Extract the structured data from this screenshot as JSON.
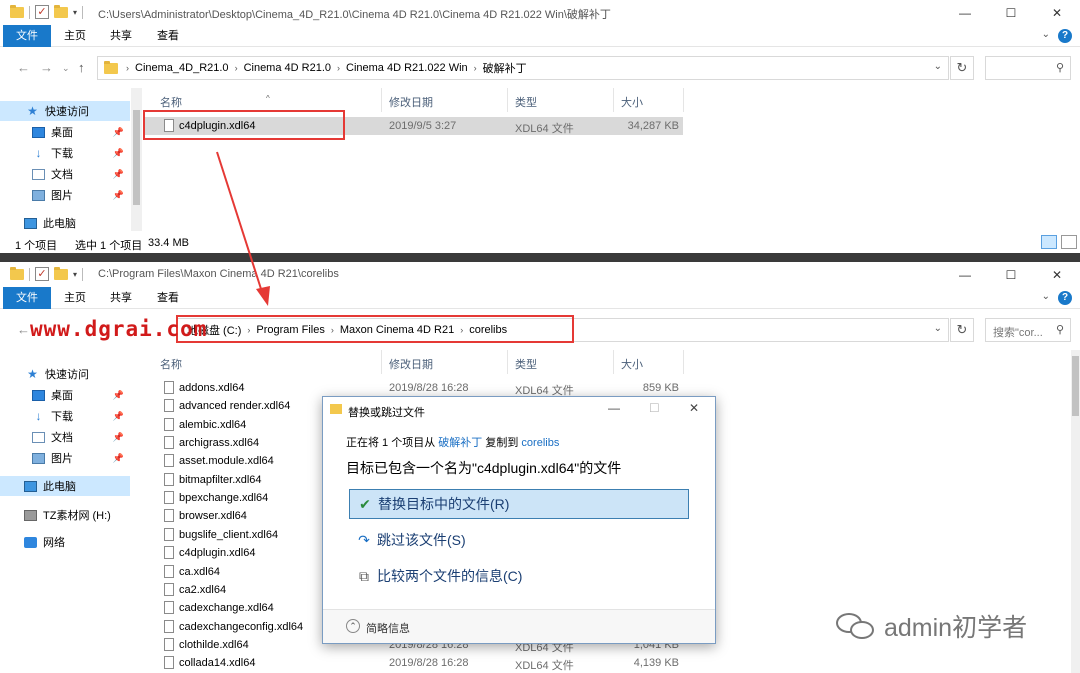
{
  "top_window": {
    "title_path": "C:\\Users\\Administrator\\Desktop\\Cinema_4D_R21.0\\Cinema 4D R21.0\\Cinema 4D R21.022 Win\\破解补丁",
    "ribbon_tabs": [
      "文件",
      "主页",
      "共享",
      "查看"
    ],
    "breadcrumbs": [
      "Cinema_4D_R21.0",
      "Cinema 4D R21.0",
      "Cinema 4D R21.022 Win",
      "破解补丁"
    ],
    "search_placeholder": "",
    "sidebar": [
      "快速访问",
      "桌面",
      "下载",
      "文档",
      "图片",
      "此电脑"
    ],
    "columns": [
      "名称",
      "修改日期",
      "类型",
      "大小"
    ],
    "files": [
      {
        "name": "c4dplugin.xdl64",
        "date": "2019/9/5 3:27",
        "type": "XDL64 文件",
        "size": "34,287 KB"
      }
    ],
    "status": {
      "count": "1 个项目",
      "selected": "选中 1 个项目",
      "size": "33.4 MB"
    }
  },
  "bottom_window": {
    "title_path": "C:\\Program Files\\Maxon Cinema 4D R21\\corelibs",
    "ribbon_tabs": [
      "文件",
      "主页",
      "共享",
      "查看"
    ],
    "breadcrumbs": [
      "本地磁盘 (C:)",
      "Program Files",
      "Maxon Cinema 4D R21",
      "corelibs"
    ],
    "breadcrumb_prefix": "地磁盘 (C:)",
    "search_placeholder": "搜索\"cor...",
    "sidebar": [
      "快速访问",
      "桌面",
      "下载",
      "文档",
      "图片",
      "此电脑",
      "TZ素材网 (H:)",
      "网络"
    ],
    "columns": [
      "名称",
      "修改日期",
      "类型",
      "大小"
    ],
    "files": [
      {
        "name": "addons.xdl64",
        "date": "2019/8/28 16:28",
        "type": "XDL64 文件",
        "size": "859 KB"
      },
      {
        "name": "advanced render.xdl64",
        "date": "",
        "type": "",
        "size": ""
      },
      {
        "name": "alembic.xdl64",
        "date": "",
        "type": "",
        "size": ""
      },
      {
        "name": "archigrass.xdl64",
        "date": "",
        "type": "",
        "size": ""
      },
      {
        "name": "asset.module.xdl64",
        "date": "",
        "type": "",
        "size": ""
      },
      {
        "name": "bitmapfilter.xdl64",
        "date": "",
        "type": "",
        "size": ""
      },
      {
        "name": "bpexchange.xdl64",
        "date": "",
        "type": "",
        "size": ""
      },
      {
        "name": "browser.xdl64",
        "date": "",
        "type": "",
        "size": ""
      },
      {
        "name": "bugslife_client.xdl64",
        "date": "",
        "type": "",
        "size": ""
      },
      {
        "name": "c4dplugin.xdl64",
        "date": "",
        "type": "",
        "size": ""
      },
      {
        "name": "ca.xdl64",
        "date": "",
        "type": "",
        "size": ""
      },
      {
        "name": "ca2.xdl64",
        "date": "",
        "type": "",
        "size": ""
      },
      {
        "name": "cadexchange.xdl64",
        "date": "",
        "type": "",
        "size": ""
      },
      {
        "name": "cadexchangeconfig.xdl64",
        "date": "",
        "type": "",
        "size": ""
      },
      {
        "name": "clothilde.xdl64",
        "date": "2019/8/28 16:28",
        "type": "XDL64 文件",
        "size": "1,041 KB"
      },
      {
        "name": "collada14.xdl64",
        "date": "2019/8/28 16:28",
        "type": "XDL64 文件",
        "size": "4,139 KB"
      }
    ]
  },
  "dialog": {
    "title": "替换或跳过文件",
    "line1_prefix": "正在将 1 个项目从",
    "line1_src": "破解补丁",
    "line1_mid": "复制到",
    "line1_dst": "corelibs",
    "line2": "目标已包含一个名为\"c4dplugin.xdl64\"的文件",
    "options": [
      "替换目标中的文件(R)",
      "跳过该文件(S)",
      "比较两个文件的信息(C)"
    ],
    "footer": "简略信息"
  },
  "watermark_url": "www.dgrai.com",
  "wechat_text": "admin初学者",
  "colors": {
    "accent": "#1979ca",
    "highlight_red": "#e53935",
    "selection": "#cce8ff"
  }
}
